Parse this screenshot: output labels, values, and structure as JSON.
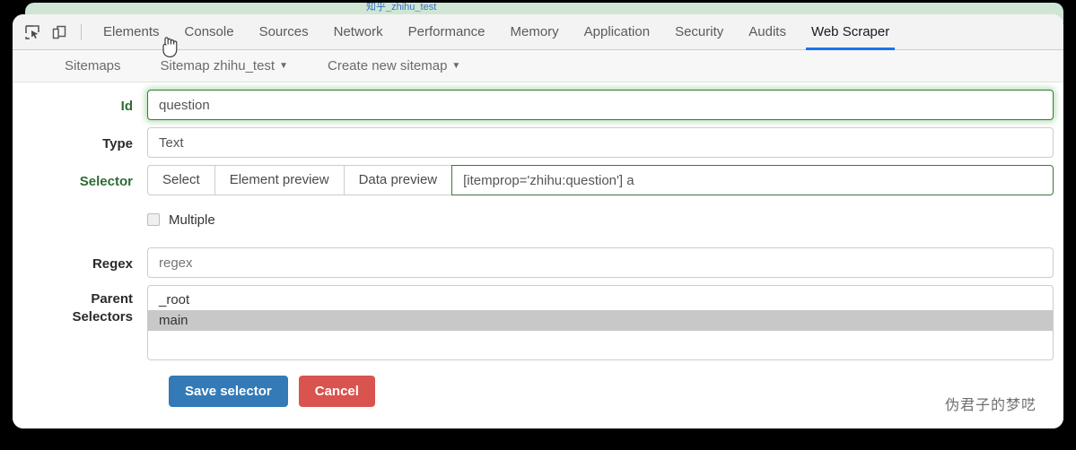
{
  "window": {
    "underlying_page_title": "知乎_zhihu_test"
  },
  "devtools": {
    "toolbar_icons": [
      {
        "name": "inspect-element-icon",
        "glyph": "inspect"
      },
      {
        "name": "device-toolbar-icon",
        "glyph": "device"
      }
    ],
    "tabs": [
      {
        "label": "Elements",
        "active": false
      },
      {
        "label": "Console",
        "active": false
      },
      {
        "label": "Sources",
        "active": false
      },
      {
        "label": "Network",
        "active": false
      },
      {
        "label": "Performance",
        "active": false
      },
      {
        "label": "Memory",
        "active": false
      },
      {
        "label": "Application",
        "active": false
      },
      {
        "label": "Security",
        "active": false
      },
      {
        "label": "Audits",
        "active": false
      },
      {
        "label": "Web Scraper",
        "active": true
      }
    ],
    "active_tab": "Web Scraper",
    "accent_color": "#1a73e8"
  },
  "nav": {
    "items": [
      {
        "label": "Sitemaps",
        "has_caret": false
      },
      {
        "label": "Sitemap zhihu_test",
        "has_caret": true
      },
      {
        "label": "Create new sitemap",
        "has_caret": true
      }
    ]
  },
  "form": {
    "id": {
      "label": "Id",
      "value": "question",
      "state": "valid"
    },
    "type": {
      "label": "Type",
      "value": "Text"
    },
    "selector": {
      "label": "Selector",
      "buttons": [
        "Select",
        "Element preview",
        "Data preview"
      ],
      "value": "[itemprop='zhihu:question'] a",
      "state": "valid"
    },
    "multiple": {
      "label": "Multiple",
      "checked": false
    },
    "regex": {
      "label": "Regex",
      "value": "",
      "placeholder": "regex"
    },
    "parent_selectors": {
      "label_line1": "Parent",
      "label_line2": "Selectors",
      "options": [
        {
          "label": "_root",
          "selected": false
        },
        {
          "label": "main",
          "selected": true
        }
      ]
    },
    "actions": {
      "save": "Save selector",
      "cancel": "Cancel",
      "save_color": "#337ab7",
      "cancel_color": "#d9534f"
    }
  },
  "watermark": {
    "text": "伪君子的梦呓"
  }
}
